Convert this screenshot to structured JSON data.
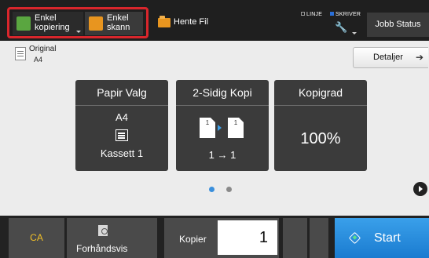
{
  "header": {
    "modes": [
      {
        "label": "Enkel kopiering",
        "icon": "copy-icon",
        "selected": true
      },
      {
        "label": "Enkel skann",
        "icon": "scan-icon",
        "selected": false
      }
    ],
    "hente_fil": "Hente Fil",
    "status_linje": "LINJE",
    "status_skriver": "SKRIVER",
    "jobb_status": "Jobb Status",
    "colors": {
      "highlight": "#d9262c",
      "copy_icon": "#5aa640",
      "scan_icon": "#e8951f",
      "skriver_indicator": "#2a6fd8"
    }
  },
  "original": {
    "label": "Original",
    "size": "A4"
  },
  "detaljer": "Detaljer",
  "cards": {
    "papir": {
      "title": "Papir Valg",
      "size": "A4",
      "tray": "Kassett 1"
    },
    "sidig": {
      "title": "2-Sidig Kopi",
      "sheet1": "1",
      "sheet2": "1",
      "value": "1 → 1"
    },
    "kopigrad": {
      "title": "Kopigrad",
      "value": "100%"
    }
  },
  "pagination": {
    "pages": 2,
    "current": 1
  },
  "footer": {
    "ca": "CA",
    "forhandsvis": "Forhåndsvis",
    "kopier_label": "Kopier",
    "kopier_value": "1",
    "start": "Start",
    "colors": {
      "ca_text": "#f2c027",
      "start_bg": "#2a8fe0"
    }
  }
}
